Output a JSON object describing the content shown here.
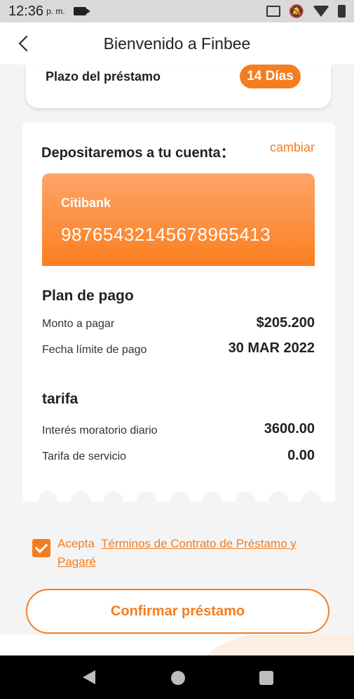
{
  "status_bar": {
    "time": "12:36",
    "ampm": "p. m."
  },
  "header": {
    "title": "Bienvenido a Finbee"
  },
  "loan_term": {
    "label": "Plazo del préstamo",
    "value": "14 Días"
  },
  "deposit": {
    "label": "Depositaremos a tu cuenta：",
    "change_link": "cambiar",
    "bank_name": "Citibank",
    "account_number": "98765432145678965413"
  },
  "payment_plan": {
    "title": "Plan de pago",
    "rows": [
      {
        "label": "Monto a pagar",
        "value": "$205.200"
      },
      {
        "label": "Fecha límite de pago",
        "value": "30 MAR 2022"
      }
    ]
  },
  "fees": {
    "title": "tarifa",
    "rows": [
      {
        "label": "Interés moratorio diario",
        "value": "3600.00"
      },
      {
        "label": "Tarifa de servicio",
        "value": "0.00"
      }
    ]
  },
  "terms": {
    "checked": true,
    "prefix": "Acepta",
    "link_text": "Términos de Contrato de Préstamo y Pagaré"
  },
  "confirm_button": "Confirmar préstamo",
  "colors": {
    "accent": "#f47d20",
    "card_gradient_top": "#fda568",
    "card_gradient_bottom": "#fb7e1f"
  },
  "icons": [
    "camera-icon",
    "cast-icon",
    "bell-off-icon",
    "wifi-icon",
    "battery-icon",
    "back-arrow-icon",
    "check-icon",
    "nav-back-icon",
    "nav-home-icon",
    "nav-recent-icon"
  ]
}
